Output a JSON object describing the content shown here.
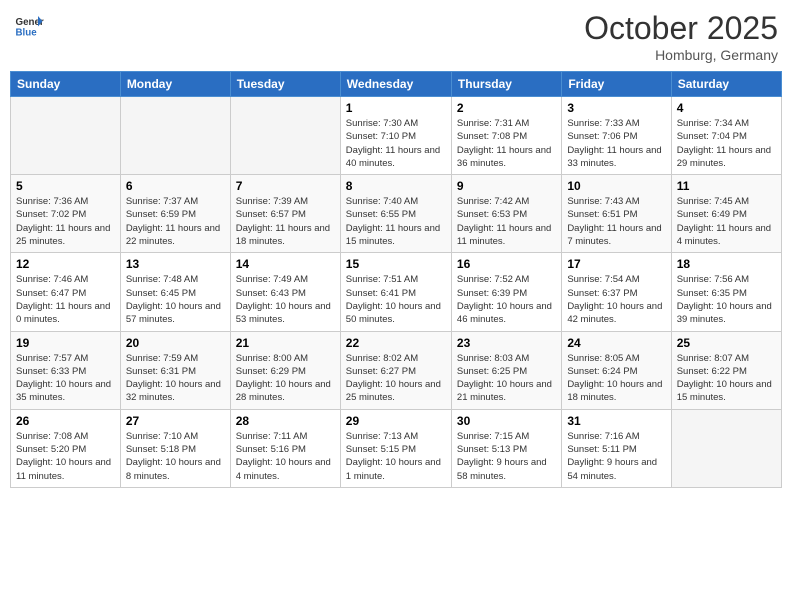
{
  "header": {
    "logo_line1": "General",
    "logo_line2": "Blue",
    "month": "October 2025",
    "location": "Homburg, Germany"
  },
  "weekdays": [
    "Sunday",
    "Monday",
    "Tuesday",
    "Wednesday",
    "Thursday",
    "Friday",
    "Saturday"
  ],
  "weeks": [
    [
      {
        "day": "",
        "info": ""
      },
      {
        "day": "",
        "info": ""
      },
      {
        "day": "",
        "info": ""
      },
      {
        "day": "1",
        "info": "Sunrise: 7:30 AM\nSunset: 7:10 PM\nDaylight: 11 hours\nand 40 minutes."
      },
      {
        "day": "2",
        "info": "Sunrise: 7:31 AM\nSunset: 7:08 PM\nDaylight: 11 hours\nand 36 minutes."
      },
      {
        "day": "3",
        "info": "Sunrise: 7:33 AM\nSunset: 7:06 PM\nDaylight: 11 hours\nand 33 minutes."
      },
      {
        "day": "4",
        "info": "Sunrise: 7:34 AM\nSunset: 7:04 PM\nDaylight: 11 hours\nand 29 minutes."
      }
    ],
    [
      {
        "day": "5",
        "info": "Sunrise: 7:36 AM\nSunset: 7:02 PM\nDaylight: 11 hours\nand 25 minutes."
      },
      {
        "day": "6",
        "info": "Sunrise: 7:37 AM\nSunset: 6:59 PM\nDaylight: 11 hours\nand 22 minutes."
      },
      {
        "day": "7",
        "info": "Sunrise: 7:39 AM\nSunset: 6:57 PM\nDaylight: 11 hours\nand 18 minutes."
      },
      {
        "day": "8",
        "info": "Sunrise: 7:40 AM\nSunset: 6:55 PM\nDaylight: 11 hours\nand 15 minutes."
      },
      {
        "day": "9",
        "info": "Sunrise: 7:42 AM\nSunset: 6:53 PM\nDaylight: 11 hours\nand 11 minutes."
      },
      {
        "day": "10",
        "info": "Sunrise: 7:43 AM\nSunset: 6:51 PM\nDaylight: 11 hours\nand 7 minutes."
      },
      {
        "day": "11",
        "info": "Sunrise: 7:45 AM\nSunset: 6:49 PM\nDaylight: 11 hours\nand 4 minutes."
      }
    ],
    [
      {
        "day": "12",
        "info": "Sunrise: 7:46 AM\nSunset: 6:47 PM\nDaylight: 11 hours\nand 0 minutes."
      },
      {
        "day": "13",
        "info": "Sunrise: 7:48 AM\nSunset: 6:45 PM\nDaylight: 10 hours\nand 57 minutes."
      },
      {
        "day": "14",
        "info": "Sunrise: 7:49 AM\nSunset: 6:43 PM\nDaylight: 10 hours\nand 53 minutes."
      },
      {
        "day": "15",
        "info": "Sunrise: 7:51 AM\nSunset: 6:41 PM\nDaylight: 10 hours\nand 50 minutes."
      },
      {
        "day": "16",
        "info": "Sunrise: 7:52 AM\nSunset: 6:39 PM\nDaylight: 10 hours\nand 46 minutes."
      },
      {
        "day": "17",
        "info": "Sunrise: 7:54 AM\nSunset: 6:37 PM\nDaylight: 10 hours\nand 42 minutes."
      },
      {
        "day": "18",
        "info": "Sunrise: 7:56 AM\nSunset: 6:35 PM\nDaylight: 10 hours\nand 39 minutes."
      }
    ],
    [
      {
        "day": "19",
        "info": "Sunrise: 7:57 AM\nSunset: 6:33 PM\nDaylight: 10 hours\nand 35 minutes."
      },
      {
        "day": "20",
        "info": "Sunrise: 7:59 AM\nSunset: 6:31 PM\nDaylight: 10 hours\nand 32 minutes."
      },
      {
        "day": "21",
        "info": "Sunrise: 8:00 AM\nSunset: 6:29 PM\nDaylight: 10 hours\nand 28 minutes."
      },
      {
        "day": "22",
        "info": "Sunrise: 8:02 AM\nSunset: 6:27 PM\nDaylight: 10 hours\nand 25 minutes."
      },
      {
        "day": "23",
        "info": "Sunrise: 8:03 AM\nSunset: 6:25 PM\nDaylight: 10 hours\nand 21 minutes."
      },
      {
        "day": "24",
        "info": "Sunrise: 8:05 AM\nSunset: 6:24 PM\nDaylight: 10 hours\nand 18 minutes."
      },
      {
        "day": "25",
        "info": "Sunrise: 8:07 AM\nSunset: 6:22 PM\nDaylight: 10 hours\nand 15 minutes."
      }
    ],
    [
      {
        "day": "26",
        "info": "Sunrise: 7:08 AM\nSunset: 5:20 PM\nDaylight: 10 hours\nand 11 minutes."
      },
      {
        "day": "27",
        "info": "Sunrise: 7:10 AM\nSunset: 5:18 PM\nDaylight: 10 hours\nand 8 minutes."
      },
      {
        "day": "28",
        "info": "Sunrise: 7:11 AM\nSunset: 5:16 PM\nDaylight: 10 hours\nand 4 minutes."
      },
      {
        "day": "29",
        "info": "Sunrise: 7:13 AM\nSunset: 5:15 PM\nDaylight: 10 hours\nand 1 minute."
      },
      {
        "day": "30",
        "info": "Sunrise: 7:15 AM\nSunset: 5:13 PM\nDaylight: 9 hours\nand 58 minutes."
      },
      {
        "day": "31",
        "info": "Sunrise: 7:16 AM\nSunset: 5:11 PM\nDaylight: 9 hours\nand 54 minutes."
      },
      {
        "day": "",
        "info": ""
      }
    ]
  ]
}
